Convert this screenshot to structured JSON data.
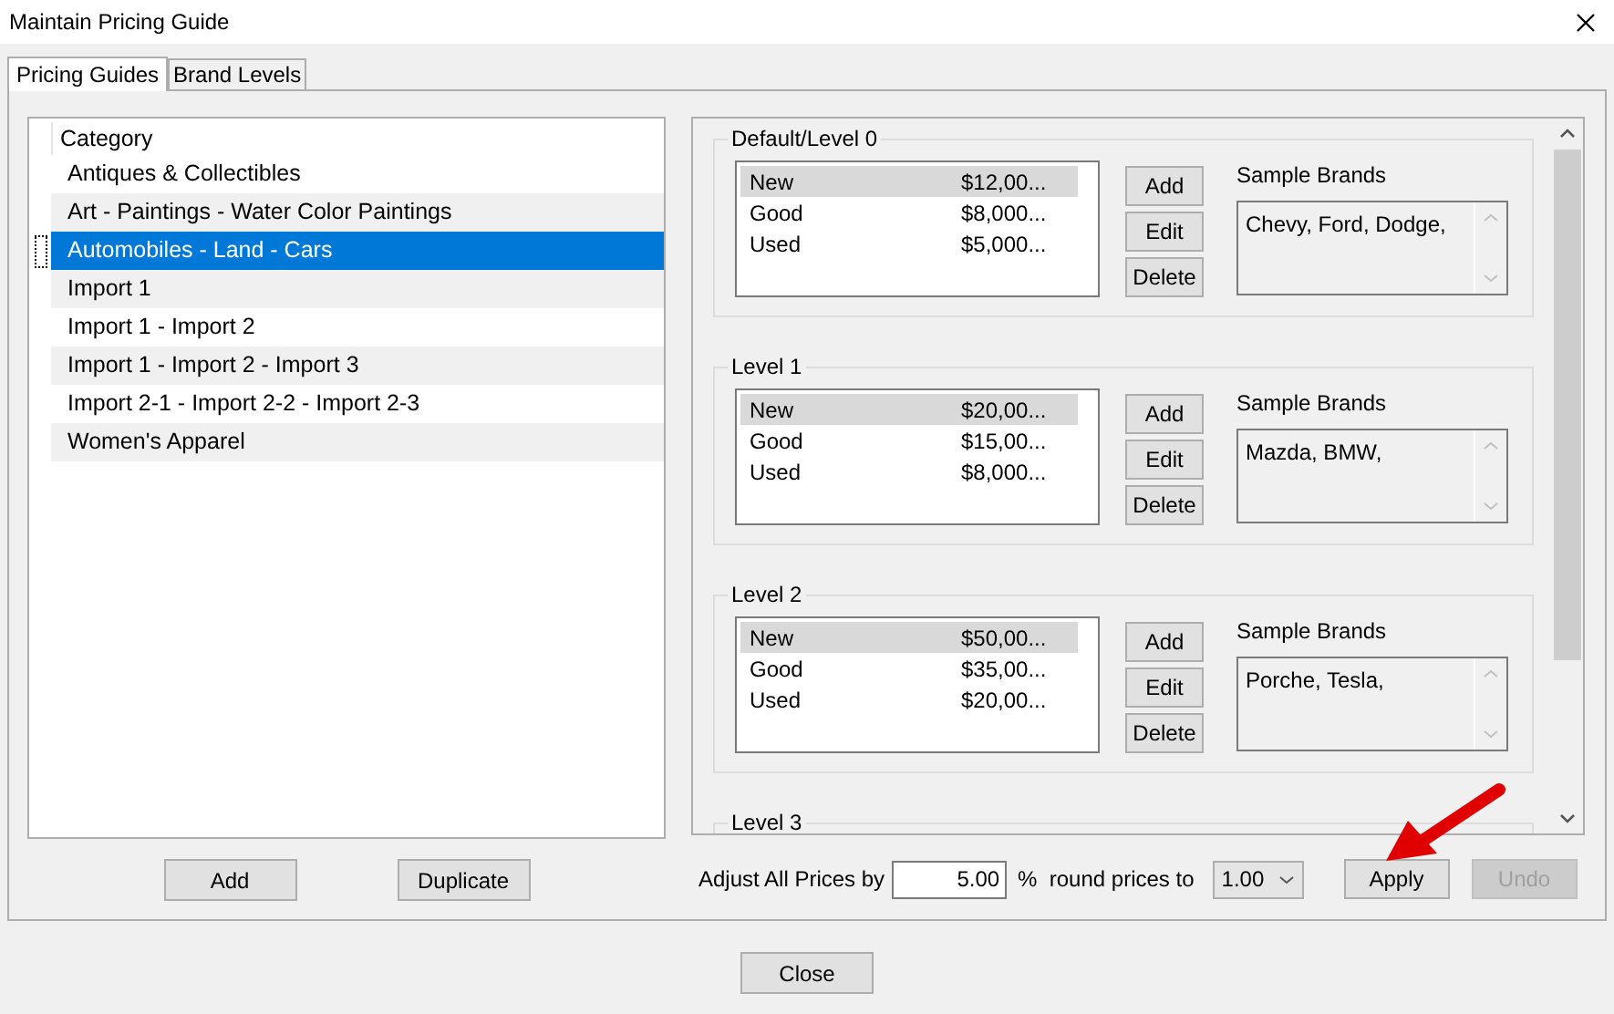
{
  "window": {
    "title": "Maintain Pricing Guide"
  },
  "tabs": [
    {
      "label": "Pricing Guides",
      "selected": true
    },
    {
      "label": "Brand Levels",
      "selected": false
    }
  ],
  "category_list": {
    "header": "Category",
    "items": [
      {
        "label": "Antiques & Collectibles",
        "selected": false
      },
      {
        "label": "Art - Paintings - Water Color Paintings",
        "selected": false
      },
      {
        "label": "Automobiles - Land - Cars",
        "selected": true
      },
      {
        "label": "Import 1",
        "selected": false
      },
      {
        "label": "Import 1 - Import 2",
        "selected": false
      },
      {
        "label": "Import 1 - Import 2 - Import 3",
        "selected": false
      },
      {
        "label": "Import 2-1 - Import 2-2 - Import 2-3",
        "selected": false
      },
      {
        "label": "Women's Apparel",
        "selected": false
      }
    ]
  },
  "category_buttons": [
    "Add",
    "Duplicate"
  ],
  "levels": [
    {
      "title": "Default/Level 0",
      "rows": [
        {
          "condition": "New",
          "price": "$12,00...",
          "selected": true
        },
        {
          "condition": "Good",
          "price": "$8,000...",
          "selected": false
        },
        {
          "condition": "Used",
          "price": "$5,000...",
          "selected": false
        }
      ],
      "buttons": [
        "Add",
        "Edit",
        "Delete"
      ],
      "brands_label": "Sample Brands",
      "brands": "Chevy,  Ford,  Dodge,"
    },
    {
      "title": "Level 1",
      "rows": [
        {
          "condition": "New",
          "price": "$20,00...",
          "selected": true
        },
        {
          "condition": "Good",
          "price": "$15,00...",
          "selected": false
        },
        {
          "condition": "Used",
          "price": "$8,000...",
          "selected": false
        }
      ],
      "buttons": [
        "Add",
        "Edit",
        "Delete"
      ],
      "brands_label": "Sample Brands",
      "brands": "Mazda,  BMW,"
    },
    {
      "title": "Level 2",
      "rows": [
        {
          "condition": "New",
          "price": "$50,00...",
          "selected": true
        },
        {
          "condition": "Good",
          "price": "$35,00...",
          "selected": false
        },
        {
          "condition": "Used",
          "price": "$20,00...",
          "selected": false
        }
      ],
      "buttons": [
        "Add",
        "Edit",
        "Delete"
      ],
      "brands_label": "Sample Brands",
      "brands": "Porche,  Tesla,"
    },
    {
      "title": "Level 3"
    }
  ],
  "adjust": {
    "label": "Adjust All Prices by",
    "value": "5.00",
    "percent_label": "%  round prices to",
    "round_value": "1.00"
  },
  "apply_button": {
    "label": "Apply",
    "disabled": false
  },
  "undo_button": {
    "label": "Undo",
    "disabled": true
  },
  "close_button": "Close"
}
